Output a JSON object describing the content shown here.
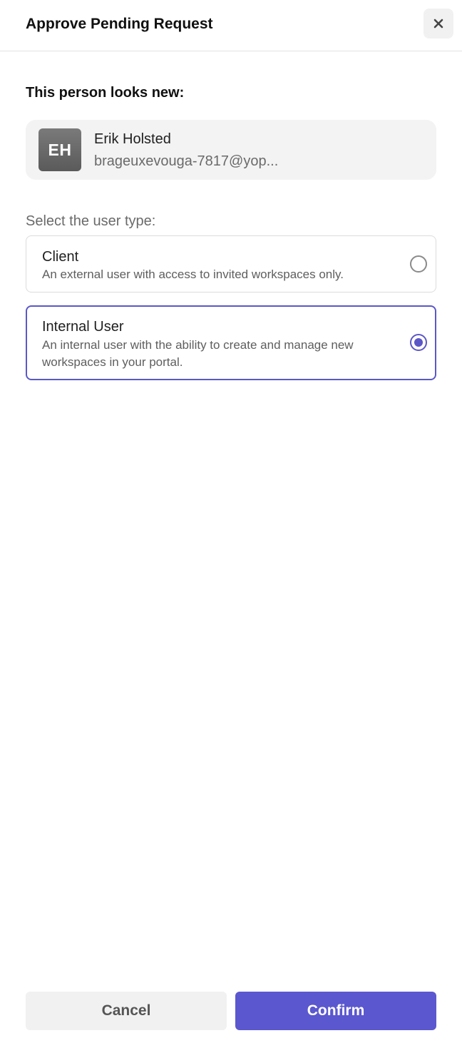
{
  "dialog": {
    "title": "Approve Pending Request",
    "close_icon": "close-icon"
  },
  "person": {
    "heading": "This person looks new:",
    "initials": "EH",
    "name": "Erik Holsted",
    "email": "brageuxevouga-7817@yop..."
  },
  "user_type": {
    "label": "Select the user type:",
    "selected": "Internal User",
    "options": [
      {
        "title": "Client",
        "description": "An external user with access to invited workspaces only.",
        "selected": false
      },
      {
        "title": "Internal User",
        "description": "An internal user with the ability to create and manage new workspaces in your portal.",
        "selected": true
      }
    ]
  },
  "footer": {
    "cancel_label": "Cancel",
    "confirm_label": "Confirm"
  },
  "colors": {
    "accent": "#5b57cf",
    "selected_border": "#5b57c7",
    "card_bg": "#f3f3f3"
  }
}
